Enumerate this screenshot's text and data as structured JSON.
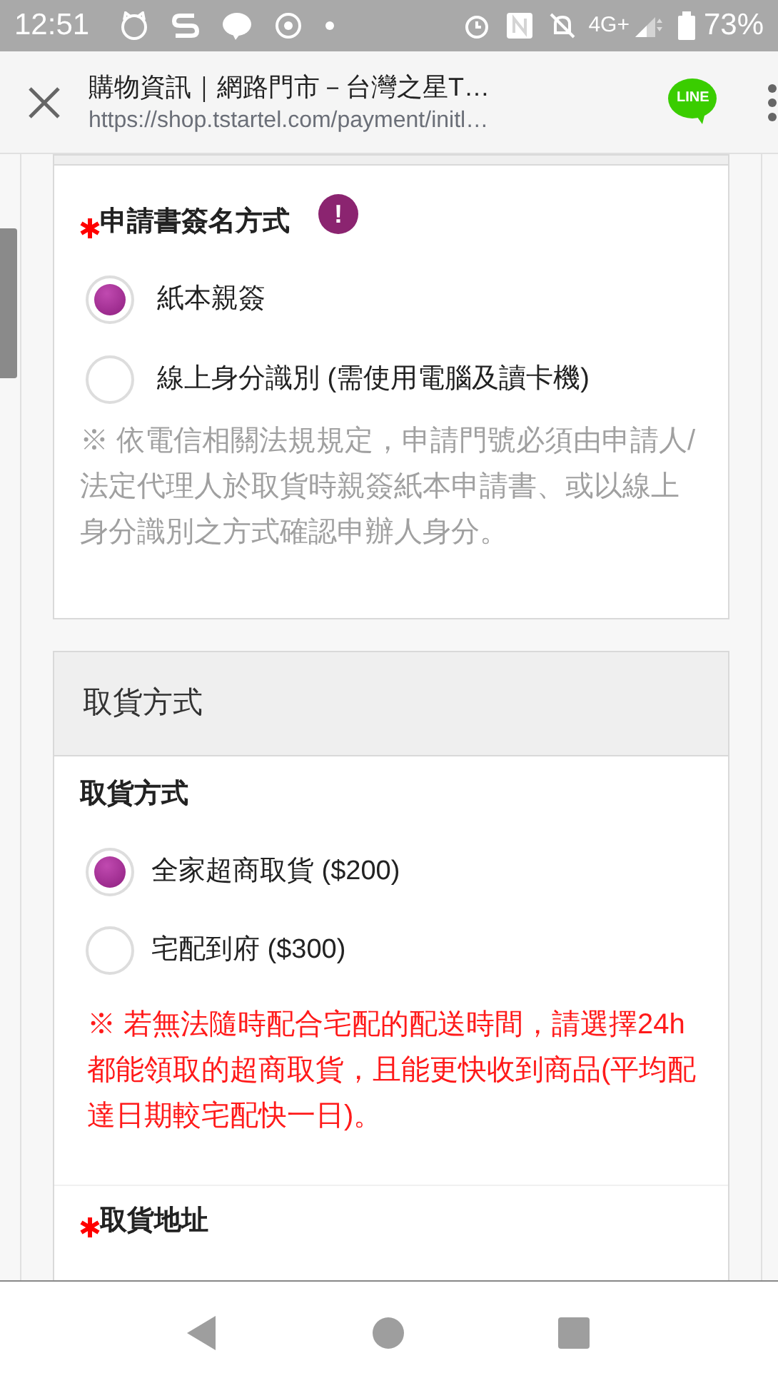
{
  "status_bar": {
    "time": "12:51",
    "network": "4G+",
    "battery": "73%"
  },
  "browser": {
    "title": "購物資訊｜網路門市－台灣之星T…",
    "url": "https://shop.tstartel.com/payment/initl…",
    "share_badge": "LINE"
  },
  "sections": [
    {
      "fields": [
        {
          "label": "申請書簽名方式",
          "required": true,
          "info": "!",
          "options": [
            {
              "label": "紙本親簽",
              "selected": true
            },
            {
              "label": "線上身分識別 (需使用電腦及讀卡機)",
              "selected": false
            }
          ],
          "note": {
            "text": "※ 依電信相關法規規定，申請門號必須由申請人/法定代理人於取貨時親簽紙本申請書、或以線上身分識別之方式確認申辦人身分。",
            "kind": "muted"
          }
        }
      ]
    },
    {
      "title": "取貨方式",
      "fields": [
        {
          "label": "取貨方式",
          "required": false,
          "options": [
            {
              "label": "全家超商取貨 ($200)",
              "selected": true
            },
            {
              "label": "宅配到府 ($300)",
              "selected": false
            }
          ],
          "note": {
            "text": "※ 若無法隨時配合宅配的配送時間，請選擇24h都能領取的超商取貨，且能更快收到商品(平均配達日期較宅配快一日)。",
            "kind": "warning"
          }
        },
        {
          "label": "取貨地址",
          "required": true
        }
      ]
    }
  ]
}
